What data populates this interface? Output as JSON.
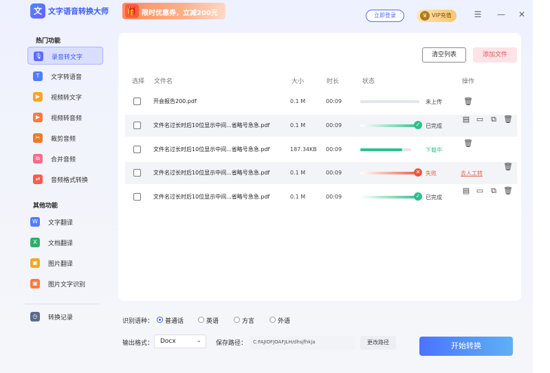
{
  "app": {
    "title": "文字语音转换大师",
    "promo": "限时优惠券，立减200元",
    "login": "立即登录",
    "vip": "VIP充值"
  },
  "sidebar": {
    "hot_title": "热门功能",
    "other_title": "其他功能",
    "items": [
      {
        "label": "录音转文字",
        "icon": "mic-icon",
        "color": "#5b6cff"
      },
      {
        "label": "文字转语音",
        "icon": "text-icon",
        "color": "#4f7dff"
      },
      {
        "label": "视频转文字",
        "icon": "video-icon",
        "color": "#f5a623"
      },
      {
        "label": "视频转音频",
        "icon": "video-audio-icon",
        "color": "#ff7a3c"
      },
      {
        "label": "裁剪音频",
        "icon": "crop-icon",
        "color": "#f07a2a"
      },
      {
        "label": "合并音频",
        "icon": "merge-icon",
        "color": "#ff6a8a"
      },
      {
        "label": "音频格式转换",
        "icon": "convert-icon",
        "color": "#ff5a4a"
      }
    ],
    "other_items": [
      {
        "label": "文字翻译",
        "icon": "word-icon",
        "color": "#4f7dff"
      },
      {
        "label": "文档翻译",
        "icon": "excel-icon",
        "color": "#2fae6a"
      },
      {
        "label": "图片翻译",
        "icon": "image-icon",
        "color": "#f5a623"
      },
      {
        "label": "图片文字识别",
        "icon": "ocr-icon",
        "color": "#ff7a3c"
      }
    ],
    "history": "转换记录"
  },
  "toolbar": {
    "clear": "清空列表",
    "add": "添加文件"
  },
  "table": {
    "headers": [
      "选择",
      "文件名",
      "大小",
      "时长",
      "状态",
      "操作"
    ],
    "rows": [
      {
        "name": "开会报告200.pdf",
        "size": "0.1 M",
        "duration": "00:09",
        "progress": 0,
        "status": "未上传",
        "state": "pending"
      },
      {
        "name": "文件名过长时后10位显示中间...省略号急急.pdf",
        "size": "0.1 M",
        "duration": "00:09",
        "progress": 100,
        "status": "已完成",
        "state": "done"
      },
      {
        "name": "文件名过长时后10位显示中间...省略号急急.pdf",
        "size": "187.34KB",
        "duration": "00:09",
        "progress": 83,
        "status": "下载中",
        "state": "downloading"
      },
      {
        "name": "文件名过长时后10位显示中间...省略号急急.pdf",
        "size": "0.1 M",
        "duration": "00:09",
        "progress": 100,
        "status": "失败",
        "state": "failed",
        "action": "去人工转"
      },
      {
        "name": "文件名过长时后10位显示中间...省略号急急.pdf",
        "size": "0.1 M",
        "duration": "00:09",
        "progress": 100,
        "status": "已完成",
        "state": "done"
      }
    ]
  },
  "settings": {
    "lang_label": "识别语种：",
    "langs": [
      "普通话",
      "英语",
      "方言",
      "外语"
    ],
    "selected_lang": "普通话",
    "format_label": "输出格式：",
    "format": "Docx",
    "path_label": "保存路径：",
    "path": "C:FAJIOFJOAFJLH/dhsjfhkja",
    "change_path": "更改路径",
    "start": "开始转换"
  },
  "colors": {
    "accent": "#3b5bff",
    "success": "#2fbf8a",
    "fail": "#f0573c",
    "download": "#2fbf8a"
  }
}
